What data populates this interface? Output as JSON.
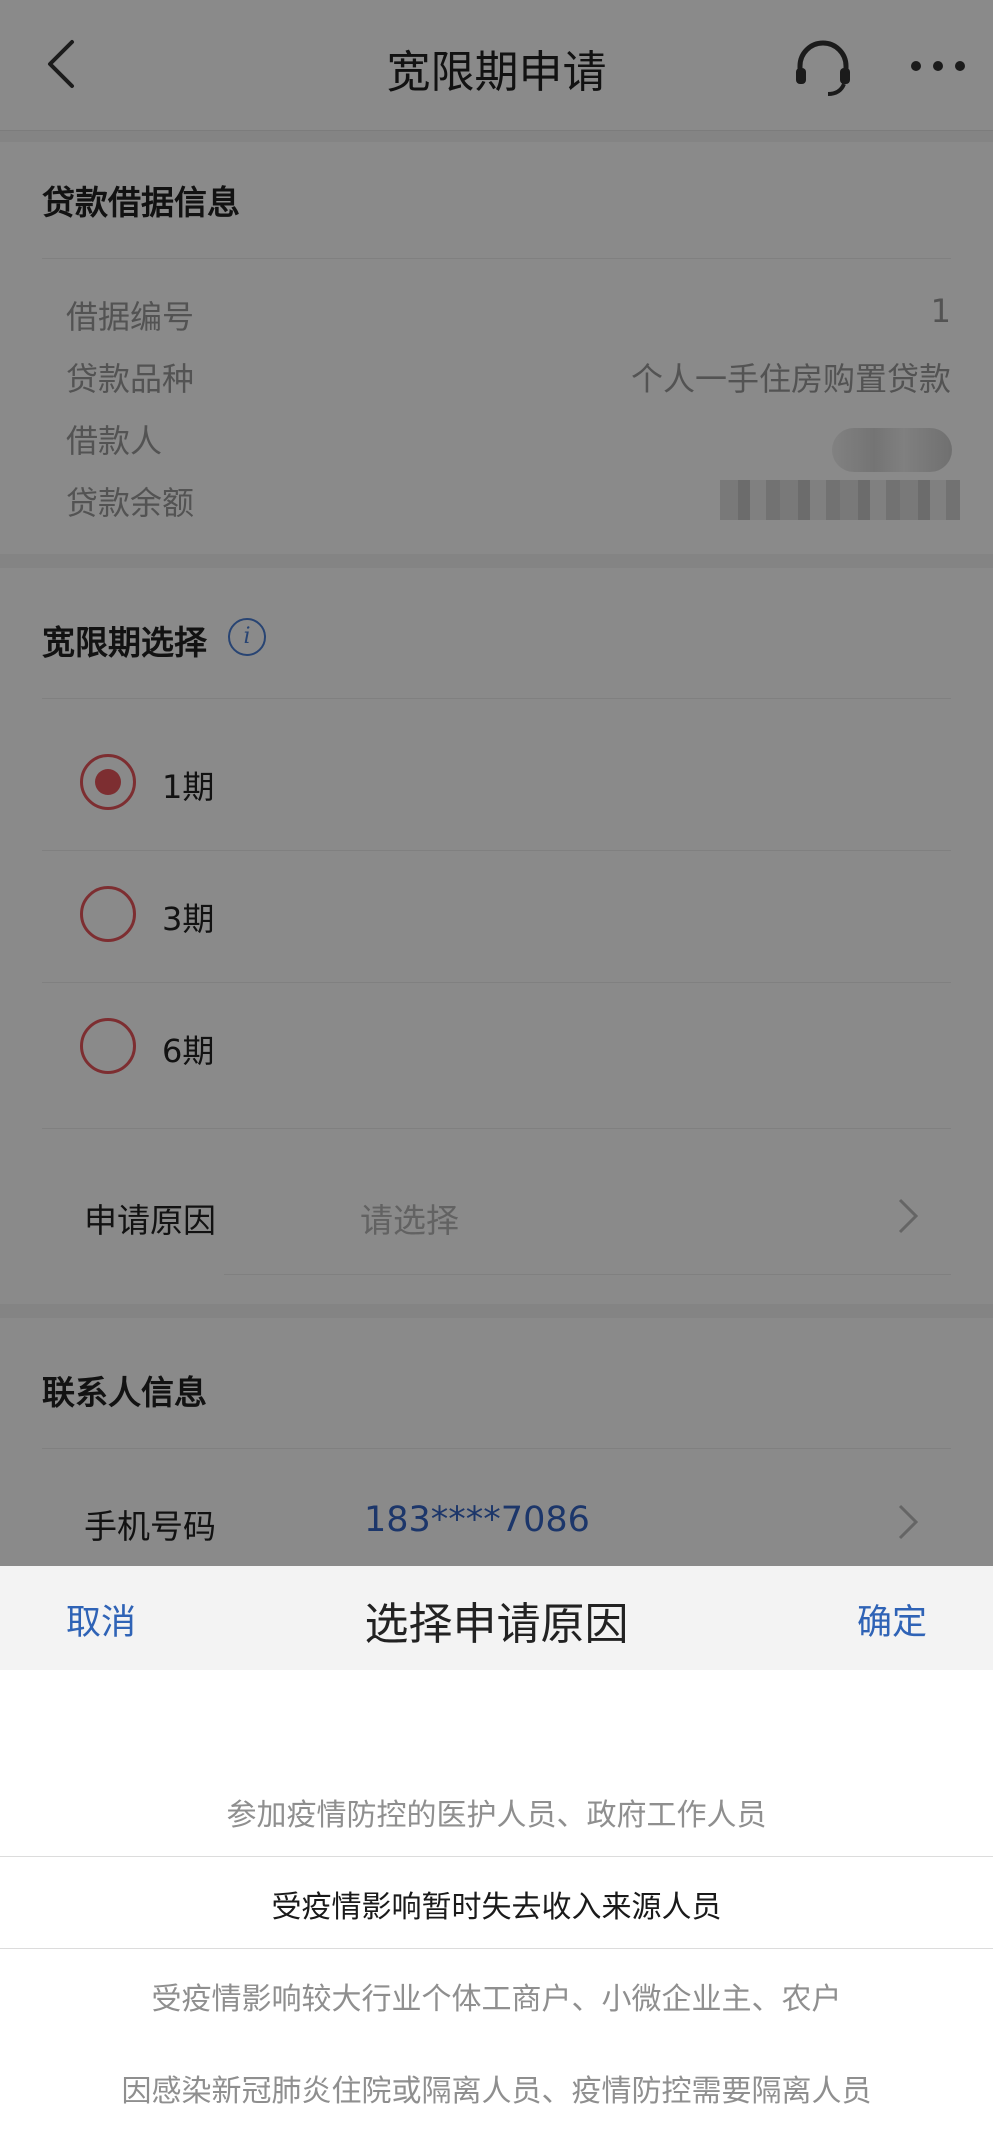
{
  "header": {
    "title": "宽限期申请",
    "back_icon": "chevron-left-icon",
    "support_icon": "headset-icon",
    "more_icon": "more-dots-icon"
  },
  "loan_info": {
    "section_title": "贷款借据信息",
    "rows": [
      {
        "label": "借据编号",
        "value": "1"
      },
      {
        "label": "贷款品种",
        "value": "个人一手住房购置贷款"
      },
      {
        "label": "借款人",
        "value": ""
      },
      {
        "label": "贷款余额",
        "value": ""
      }
    ]
  },
  "grace": {
    "section_title": "宽限期选择",
    "info_icon": "info-icon",
    "options": [
      {
        "label": "1期",
        "selected": true
      },
      {
        "label": "3期",
        "selected": false
      },
      {
        "label": "6期",
        "selected": false
      }
    ],
    "reason_label": "申请原因",
    "reason_placeholder": "请选择"
  },
  "contact": {
    "section_title": "联系人信息",
    "phone_label": "手机号码",
    "phone_value": "183****7086"
  },
  "picker": {
    "cancel": "取消",
    "title": "选择申请原因",
    "confirm": "确定",
    "options": [
      "参加疫情防控的医护人员、政府工作人员",
      "受疫情影响暂时失去收入来源人员",
      "受疫情影响较大行业个体工商户、小微企业主、农户",
      "因感染新冠肺炎住院或隔离人员、疫情防控需要隔离人员"
    ],
    "selected_index": 1
  },
  "colors": {
    "accent_red": "#e8565c",
    "link_blue": "#2f63b6",
    "phone_blue": "#3464c4"
  }
}
